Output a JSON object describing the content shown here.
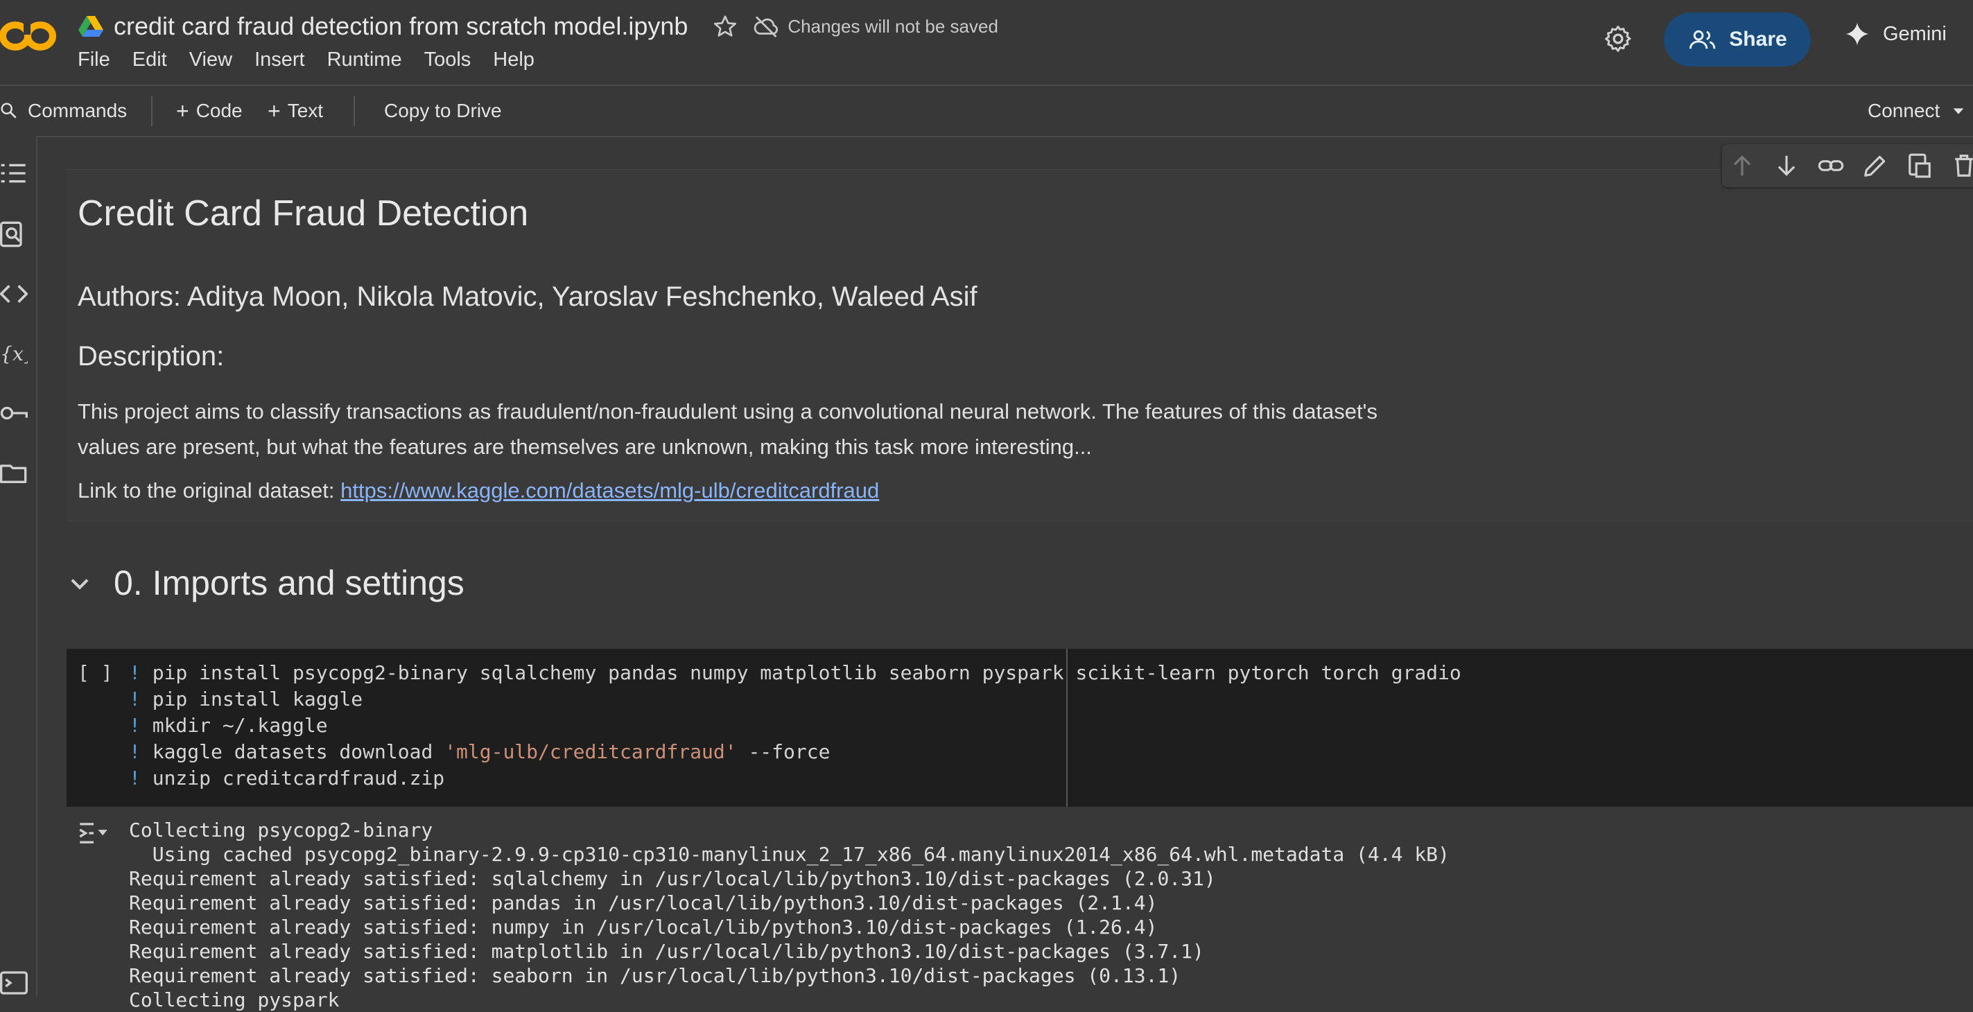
{
  "header": {
    "doc_title": "credit card fraud detection from scratch model.ipynb",
    "save_status": "Changes will not be saved",
    "share_label": "Share",
    "gemini_label": "Gemini",
    "menu": [
      "File",
      "Edit",
      "View",
      "Insert",
      "Runtime",
      "Tools",
      "Help"
    ]
  },
  "toolbar": {
    "commands_label": "Commands",
    "code_label": "Code",
    "text_label": "Text",
    "copy_label": "Copy to Drive",
    "connect_label": "Connect"
  },
  "text_cell": {
    "title": "Credit Card Fraud Detection",
    "authors": "Authors: Aditya Moon, Nikola Matovic, Yaroslav Feshchenko, Waleed Asif",
    "description_heading": "Description:",
    "description_line1": "This project aims to classify transactions as fraudulent/non-fraudulent using a convolutional neural network. The features of this dataset's",
    "description_line2": "values are present, but what the features are themselves are unknown, making this task more interesting...",
    "link_prefix": "Link to the original dataset: ",
    "link_text": "https://www.kaggle.com/datasets/mlg-ulb/creditcardfraud"
  },
  "section": {
    "title": "0. Imports and settings"
  },
  "code_cell": {
    "run_label": "[ ]",
    "lines": [
      {
        "bang": "!",
        "text": " pip install psycopg2-binary sqlalchemy pandas numpy matplotlib seaborn pyspark scikit-learn pytorch torch gradio"
      },
      {
        "bang": "!",
        "text": " pip install kaggle"
      },
      {
        "bang": "!",
        "text": " mkdir ~/.kaggle"
      },
      {
        "bang": "!",
        "text": " kaggle datasets download ",
        "str": "'mlg-ulb/creditcardfraud'",
        "rest": " --force"
      },
      {
        "bang": "!",
        "text": " unzip creditcardfraud.zip"
      }
    ]
  },
  "output": {
    "lines": [
      "Collecting psycopg2-binary",
      "  Using cached psycopg2_binary-2.9.9-cp310-cp310-manylinux_2_17_x86_64.manylinux2014_x86_64.whl.metadata (4.4 kB)",
      "Requirement already satisfied: sqlalchemy in /usr/local/lib/python3.10/dist-packages (2.0.31)",
      "Requirement already satisfied: pandas in /usr/local/lib/python3.10/dist-packages (2.1.4)",
      "Requirement already satisfied: numpy in /usr/local/lib/python3.10/dist-packages (1.26.4)",
      "Requirement already satisfied: matplotlib in /usr/local/lib/python3.10/dist-packages (3.7.1)",
      "Requirement already satisfied: seaborn in /usr/local/lib/python3.10/dist-packages (0.13.1)",
      "Collecting pyspark"
    ]
  },
  "colors": {
    "background": "#383838",
    "code_background": "#1e1e1e",
    "link": "#8ab4f8",
    "share_button": "#1a4a7a",
    "string_literal": "#ce9178",
    "shell_bang": "#569cd6",
    "colab_logo": "#f9ab00"
  },
  "icons": [
    "colab-logo-icon",
    "drive-icon",
    "star-icon",
    "cloud-off-icon",
    "gear-icon",
    "people-icon",
    "sparkle-icon",
    "search-icon",
    "plus-icon",
    "dropdown-icon",
    "toc-icon",
    "find-icon",
    "code-snippets-icon",
    "variables-icon",
    "key-icon",
    "folder-icon",
    "terminal-icon",
    "arrow-up-icon",
    "arrow-down-icon",
    "link-icon",
    "edit-icon",
    "mirror-icon",
    "delete-icon",
    "chevron-down-icon",
    "output-icon"
  ]
}
